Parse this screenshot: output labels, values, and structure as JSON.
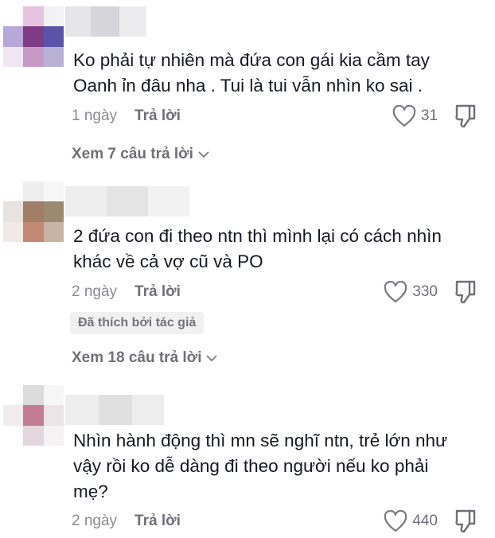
{
  "comments": [
    {
      "text_lines": [
        "Ko phải tự nhiên mà đứa con gái kia cầm tay",
        "Oanh ỉn đâu nha . Tui là tui vẫn nhìn ko sai ."
      ],
      "time": "1 ngày",
      "reply_label": "Trả lời",
      "likes": "31",
      "view_replies": "Xem 7 câu trả lời",
      "avatar_colors": [
        "#ffffff",
        "#e6c3df",
        "#f2f2f4",
        "#b8a7d9",
        "#7e3c85",
        "#5b53a9",
        "#f0e7f2",
        "#c79ac6",
        "#b9b0d6"
      ],
      "username_colors": [
        "#e6e6e9",
        "#d6d6da",
        "#ececee"
      ]
    },
    {
      "text_lines": [
        "2 đứa con đi theo ntn thì mình lại có cách nhìn",
        "khác về cả vợ cũ và PO"
      ],
      "time": "2 ngày",
      "reply_label": "Trả lời",
      "likes": "330",
      "badge": "Đã thích bởi tác giả",
      "view_replies": "Xem 18 câu trả lời",
      "avatar_colors": [
        "#ffffff",
        "#eeeeee",
        "#f7f7f7",
        "#e6e3e0",
        "#a27d67",
        "#9c8a70",
        "#f1e9e5",
        "#c28a74",
        "#c9b3a3"
      ],
      "username_colors": [
        "#eeeeee",
        "#e4e4e4",
        "#f2f2f2"
      ]
    },
    {
      "text_lines": [
        "Nhìn hành động thì mn sẽ nghĩ ntn, trẻ lớn như",
        "vậy rồi ko dễ dàng đi theo người nếu ko phải",
        "mẹ?"
      ],
      "time": "2 ngày",
      "reply_label": "Trả lời",
      "likes": "440",
      "avatar_colors": [
        "#ffffff",
        "#dcdcdc",
        "#f6f6f6",
        "#f2ecee",
        "#c37c94",
        "#ece4e6",
        "#ffffff",
        "#e4d6dd",
        "#f5f3f3"
      ],
      "username_colors": [
        "#eeeeee",
        "#e0e0e0",
        "#ededed"
      ]
    }
  ]
}
